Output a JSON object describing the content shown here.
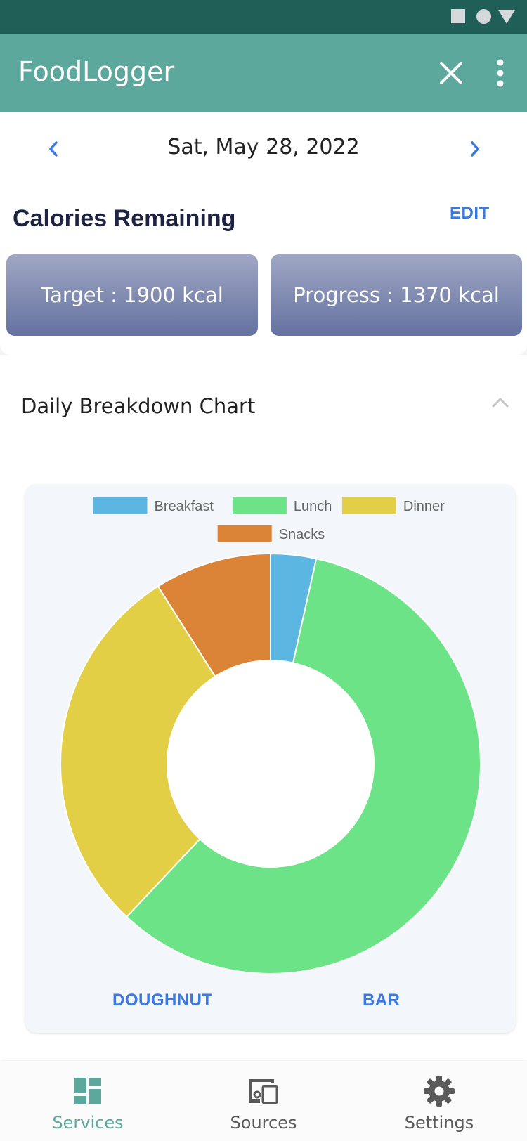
{
  "app": {
    "title": "FoodLogger"
  },
  "date": {
    "label": "Sat, May 28, 2022"
  },
  "calories": {
    "title": "Calories Remaining",
    "edit_label": "EDIT",
    "target_label": "Target : 1900 kcal",
    "progress_label": "Progress : 1370 kcal"
  },
  "breakdown": {
    "title": "Daily Breakdown Chart"
  },
  "chart_buttons": {
    "doughnut": "DOUGHNUT",
    "bar": "BAR"
  },
  "chart_data": {
    "type": "pie",
    "variant": "doughnut",
    "categories": [
      "Breakfast",
      "Lunch",
      "Dinner",
      "Snacks"
    ],
    "values": [
      3.5,
      58.5,
      29,
      9
    ],
    "colors": [
      "#5bb6e2",
      "#6be386",
      "#e2cf46",
      "#db8437"
    ],
    "legend_position": "top"
  },
  "bottom_nav": {
    "items": [
      {
        "label": "Services",
        "icon": "dashboard-icon",
        "active": true
      },
      {
        "label": "Sources",
        "icon": "devices-icon",
        "active": false
      },
      {
        "label": "Settings",
        "icon": "gear-icon",
        "active": false
      }
    ]
  },
  "colors": {
    "status_bar": "#1f5f58",
    "app_bar": "#5ca89d",
    "accent_blue": "#3a78e3",
    "active_nav": "#5ca89d"
  }
}
